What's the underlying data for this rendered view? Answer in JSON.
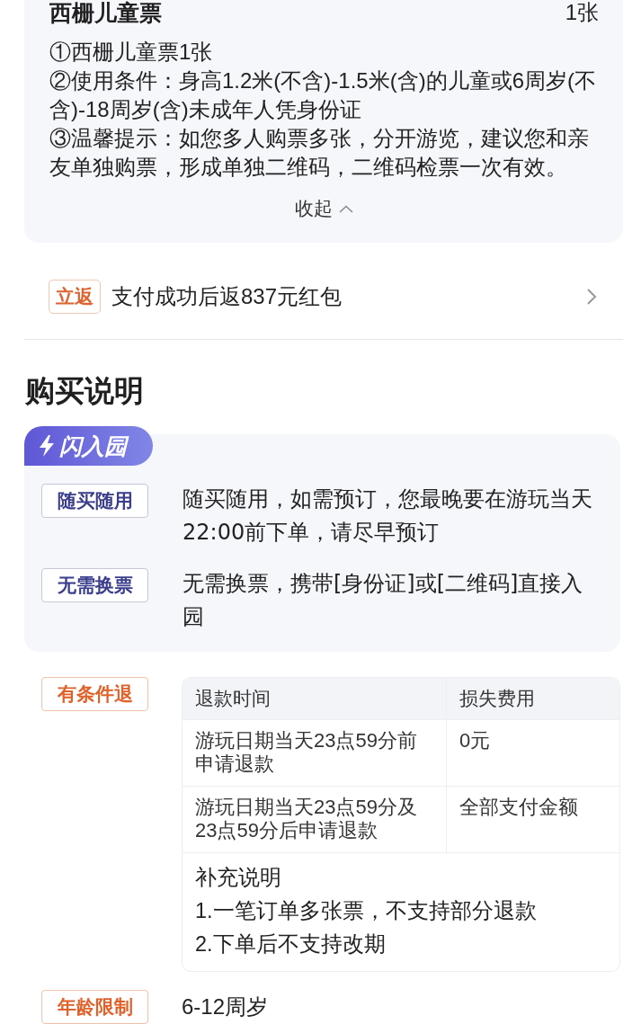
{
  "ticket_card": {
    "title": "西栅儿童票",
    "quantity": "1张",
    "details": [
      "①西栅儿童票1张",
      "②使用条件：身高1.2米(不含)-1.5米(含)的儿童或6周岁(不含)-18周岁(含)未成年人凭身份证",
      "③温馨提示：如您多人购票多张，分开游览，建议您和亲友单独购票，形成单独二维码，二维码检票一次有效。"
    ],
    "collapse_label": "收起"
  },
  "rebate": {
    "badge": "立返",
    "text": "支付成功后返837元红包"
  },
  "purchase_info": {
    "heading": "购买说明",
    "feature_card": {
      "badge": "闪入园",
      "items": [
        {
          "tag": "随买随用",
          "text": "随买随用，如需预订，您最晚要在游玩当天22:00前下单，请尽早预订"
        },
        {
          "tag": "无需换票",
          "text": "无需换票，携带[身份证]或[二维码]直接入园"
        }
      ]
    },
    "refund": {
      "tag": "有条件退",
      "table": {
        "columns": [
          "退款时间",
          "损失费用"
        ],
        "rows": [
          [
            "游玩日期当天23点59分前申请退款",
            "0元"
          ],
          [
            "游玩日期当天23点59分及23点59分后申请退款",
            "全部支付金额"
          ]
        ],
        "notes_title": "补充说明",
        "notes": [
          "1.一笔订单多张票，不支持部分退款",
          "2.下单后不支持改期"
        ]
      }
    },
    "age_limit": {
      "tag": "年龄限制",
      "text": "6-12周岁"
    }
  }
}
